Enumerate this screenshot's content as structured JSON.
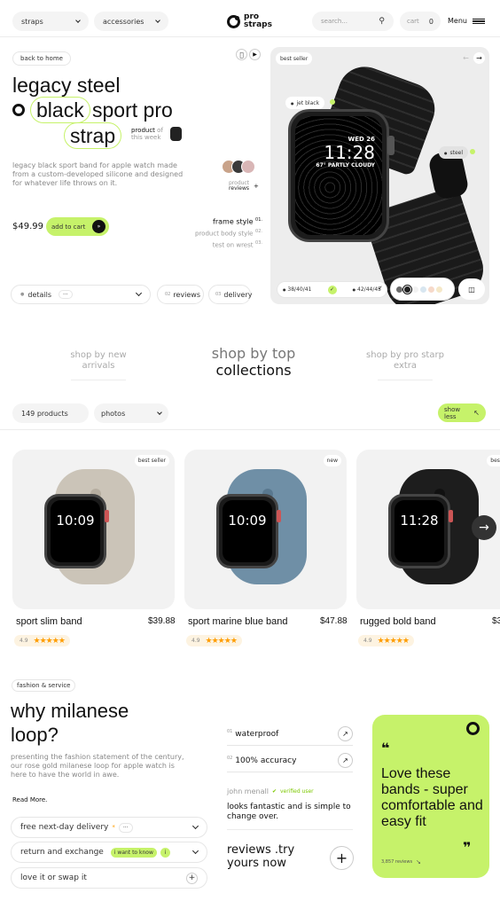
{
  "nav": {
    "filter1": "straps",
    "filter2": "accessories",
    "brand_line1": "pro",
    "brand_line2": "straps",
    "search_placeholder": "search...",
    "cart_label": "cart",
    "cart_count": "0",
    "menu_label": "Menu"
  },
  "hero": {
    "back_label": "back to home",
    "title_line1": "legacy steel",
    "title_word1": "black",
    "title_word2": "sport pro",
    "title_word3": "strap",
    "product_of": "product",
    "product_of_tail": "of",
    "this_week": "this week",
    "description": "legacy black sport band for apple watch made from a custom-developed silicone and designed for whatever life throws on it.",
    "reviews_label": "product",
    "reviews_label2": "reviews",
    "reviews_plus": "+",
    "price": "$49.99",
    "add_to_cart": "add to cart",
    "style_options": [
      {
        "label": "frame style",
        "num": "01."
      },
      {
        "label": "product body style",
        "num": "02."
      },
      {
        "label": "test on wrest",
        "num": "03."
      }
    ],
    "tabs": {
      "details": "details",
      "details_badge": "···",
      "reviews_num": "02",
      "reviews": "reviews",
      "delivery_num": "03",
      "delivery": "delivery"
    }
  },
  "showcase": {
    "badge": "best seller",
    "tag_left": "jet black",
    "tag_right": "steel",
    "watch_date": "WED 26",
    "watch_time": "11:28",
    "watch_weather": "67° PARTLY CLOUDY",
    "size1": "38/40/41",
    "size2": "42/44/45",
    "swatches": [
      "#6b6b6b",
      "#1f1f1f",
      "#f2f2f2",
      "#d8e6f0",
      "#f6d9c9",
      "#f5e8c8"
    ]
  },
  "section_tabs": {
    "left_line1": "shop by new",
    "left_line2": "arrivals",
    "center_line1": "shop by top",
    "center_line2": "collections",
    "right_line1": "shop by pro starp",
    "right_line2": "extra"
  },
  "filters": {
    "count": "149 products",
    "type": "photos",
    "show_less": "show less"
  },
  "products": [
    {
      "badge": "best seller",
      "name": "sport slim band",
      "price": "$39.88",
      "rating": "4.9",
      "time": "10:09",
      "band": "#cbc4b8",
      "band_dark": "#b5ad9f"
    },
    {
      "badge": "new",
      "name": "sport marine blue band",
      "price": "$47.88",
      "rating": "4.9",
      "time": "10:09",
      "band": "#6f8fa6",
      "band_dark": "#59788f"
    },
    {
      "badge": "best se",
      "name": "rugged bold band",
      "price": "$3",
      "rating": "4.9",
      "time": "11:28",
      "band": "#1d1d1d",
      "band_dark": "#111111"
    }
  ],
  "milanese": {
    "tag": "fashion & service",
    "title_line1": "why milanese",
    "title_line2": "loop?",
    "description": "presenting the fashion statement of the century, our rose gold milanese loop for apple watch is here to have the world in awe.",
    "read_more": "Read More.",
    "accordion": [
      {
        "label": "free next-day delivery",
        "extra": "···"
      },
      {
        "label": "return and exchange",
        "extra": "i want to know"
      },
      {
        "label": "love it or swap it"
      }
    ],
    "features": [
      {
        "num": "01",
        "label": "waterproof"
      },
      {
        "num": "02",
        "label": "100% accuracy"
      }
    ],
    "reviewer": "john menall",
    "verified": "verified user",
    "review_text": "looks fantastic and is simple to change over.",
    "reviews_cta_line1": "reviews .try",
    "reviews_cta_line2": "yours now",
    "quote": "Love these bands - super comfortable and easy fit",
    "review_count": "3,857 reviews"
  },
  "colors": {
    "accent": "#c6f26a",
    "dark": "#111111"
  }
}
